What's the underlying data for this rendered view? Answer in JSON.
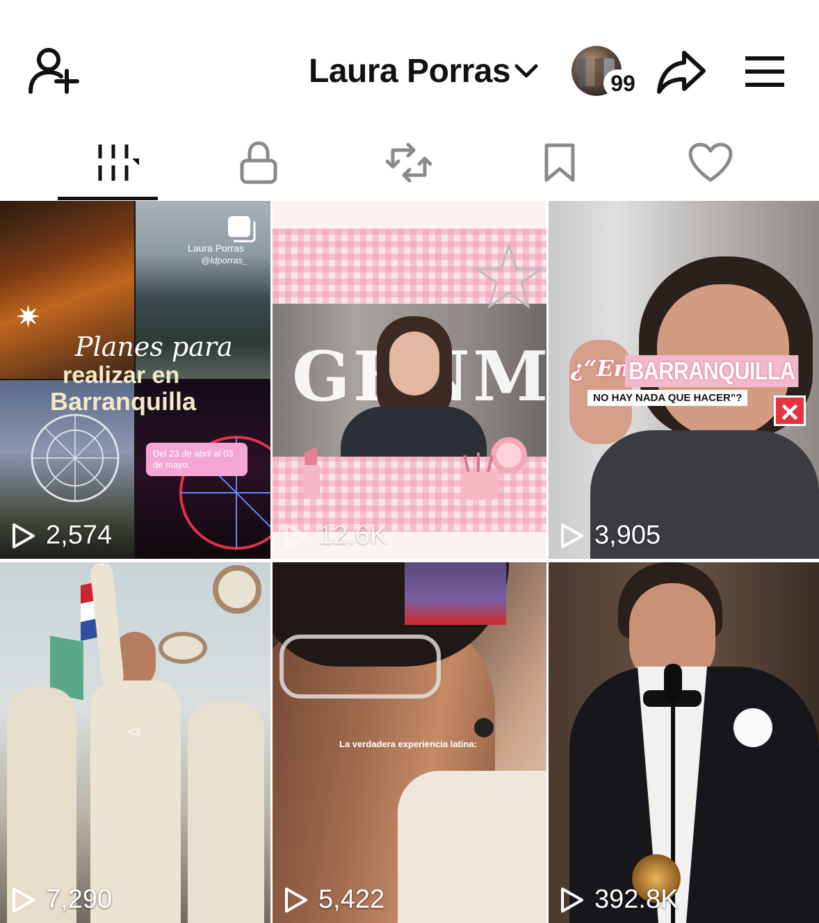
{
  "header": {
    "title": "Laura Porras",
    "avatar_badge": "99",
    "icons": [
      "add-user-icon",
      "chevron-down-icon",
      "share-icon",
      "menu-icon"
    ]
  },
  "tabs": [
    {
      "name": "videos",
      "icon": "grid-icon"
    },
    {
      "name": "private",
      "icon": "lock-icon"
    },
    {
      "name": "reposts",
      "icon": "repost-icon"
    },
    {
      "name": "favorites",
      "icon": "bookmark-icon"
    },
    {
      "name": "liked",
      "icon": "heart-icon"
    }
  ],
  "videos": [
    {
      "views": "2,574",
      "overlay": {
        "handle_name": "Laura Porras",
        "handle": "@ldporras_",
        "script_title": "Planes para",
        "title_line1": "realizar en",
        "title_line2": "Barranquilla",
        "date_note": "Del 23 de abril al 03 de mayo."
      }
    },
    {
      "views": "12.6K",
      "overlay": {
        "text": "GENM"
      }
    },
    {
      "views": "3,905",
      "overlay": {
        "prefix": "¿“En",
        "city": "BARRANQUILLA",
        "subtitle": "NO HAY NADA QUE HACER”?"
      }
    },
    {
      "views": "7,290",
      "overlay": {
        "caption": "<3"
      }
    },
    {
      "views": "5,422",
      "overlay": {
        "caption": "La verdadera experiencia latina:"
      }
    },
    {
      "views": "392.8K",
      "overlay": {}
    }
  ],
  "colors": {
    "accent": "#111111",
    "background": "#ffffff",
    "inactive_icon": "#8a8a8a"
  }
}
